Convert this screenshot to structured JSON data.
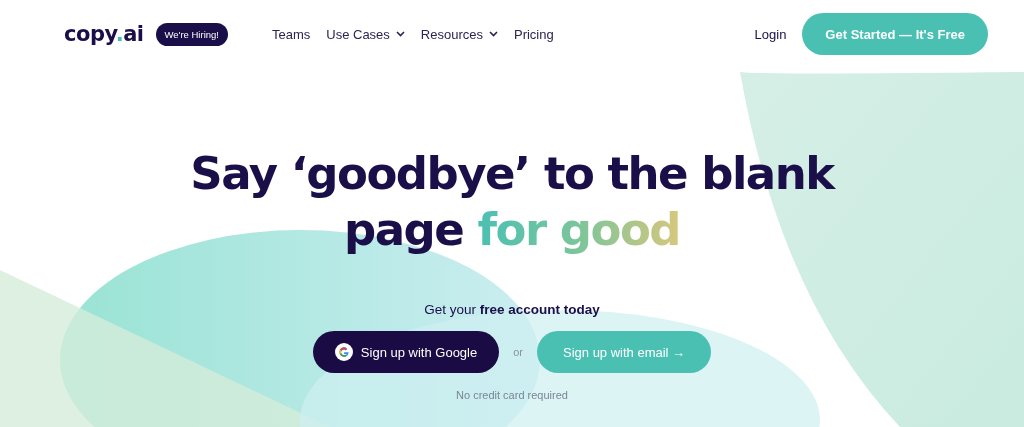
{
  "header": {
    "logo": {
      "name": "copy",
      "dot": ".",
      "suffix": "ai"
    },
    "badge": "We're Hiring!",
    "nav": [
      {
        "label": "Teams",
        "dropdown": false
      },
      {
        "label": "Use Cases",
        "dropdown": true
      },
      {
        "label": "Resources",
        "dropdown": true
      },
      {
        "label": "Pricing",
        "dropdown": false
      }
    ],
    "login": "Login",
    "cta": "Get Started — It's Free"
  },
  "hero": {
    "headline": [
      [
        {
          "text": "Say ‘goodbye’ to the blank",
          "kind": "plain"
        }
      ],
      [
        {
          "text": "page ",
          "kind": "plain"
        },
        {
          "text": "for good",
          "kind": "gradient"
        }
      ]
    ],
    "subtitle": "Get your **free account today**",
    "google_button": "Sign up with Google",
    "or": "or",
    "email_button": "Sign up with email →",
    "note": "No credit card required"
  }
}
